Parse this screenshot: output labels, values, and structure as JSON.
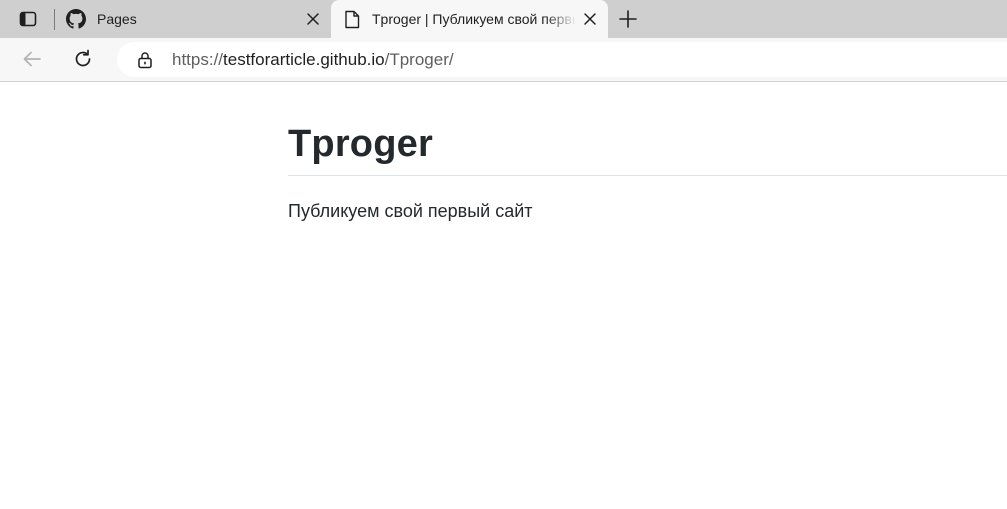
{
  "browser": {
    "tabs": [
      {
        "title": "Pages",
        "favicon": "github-icon",
        "active": false
      },
      {
        "title": "Tproger | Публикуем свой первый сайт",
        "favicon": "page-icon",
        "active": true
      }
    ],
    "address": {
      "scheme": "https://",
      "host": "testforarticle.github.io",
      "path": "/Tproger/"
    }
  },
  "page": {
    "heading": "Tproger",
    "text": "Публикуем свой первый сайт"
  },
  "icons": {
    "tab_actions": "tab-actions-icon",
    "close": "close-icon",
    "new_tab": "plus-icon",
    "back": "back-arrow-icon",
    "reload": "reload-icon",
    "site_info": "lock-icon"
  },
  "colors": {
    "tabstrip_bg": "#cfcfcf",
    "toolbar_bg": "#f7f7f7",
    "text": "#24292e",
    "rule": "#dfe2e5"
  }
}
